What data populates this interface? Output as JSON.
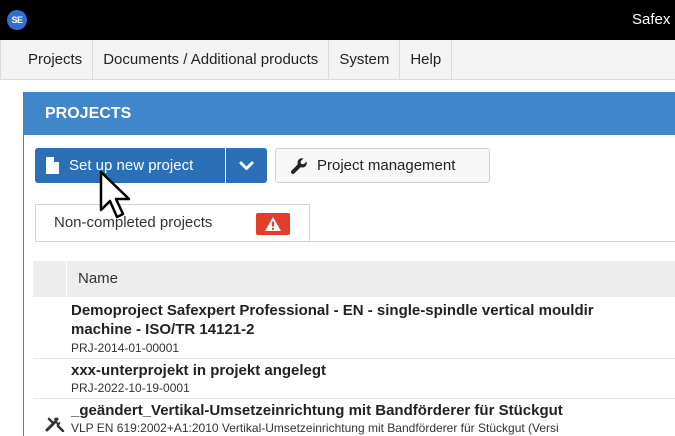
{
  "window": {
    "logo_text": "SE",
    "title": "Safex"
  },
  "menu": {
    "items": [
      {
        "label": "Projects"
      },
      {
        "label": "Documents / Additional products"
      },
      {
        "label": "System"
      },
      {
        "label": "Help"
      }
    ]
  },
  "panel": {
    "title": "PROJECTS"
  },
  "toolbar": {
    "new_project_label": "Set up new project",
    "project_management_label": "Project management"
  },
  "tabs": [
    {
      "label": "Non-completed projects",
      "badge": "warning-icon"
    }
  ],
  "table": {
    "columns": [
      "Name"
    ],
    "rows": [
      {
        "title_line1": "Demoproject Safexpert Professional - EN - single-spindle vertical mouldir",
        "title_line2": "machine - ISO/TR 14121-2",
        "sub": "PRJ-2014-01-00001"
      },
      {
        "title_line1": "xxx-unterprojekt in projekt angelegt",
        "sub": "PRJ-2022-10-19-0001"
      },
      {
        "title_line1": "_geändert_Vertikal-Umsetzeinrichtung mit Bandförderer für Stückgut",
        "sub": "VLP EN 619:2002+A1:2010 Vertikal-Umsetzeinrichtung mit Bandförderer für Stückgut (Versi",
        "icon": "tools-icon"
      }
    ]
  },
  "colors": {
    "header_blue": "#3f86cb",
    "button_blue": "#2b6fb7",
    "warning_red": "#e23c2b"
  }
}
